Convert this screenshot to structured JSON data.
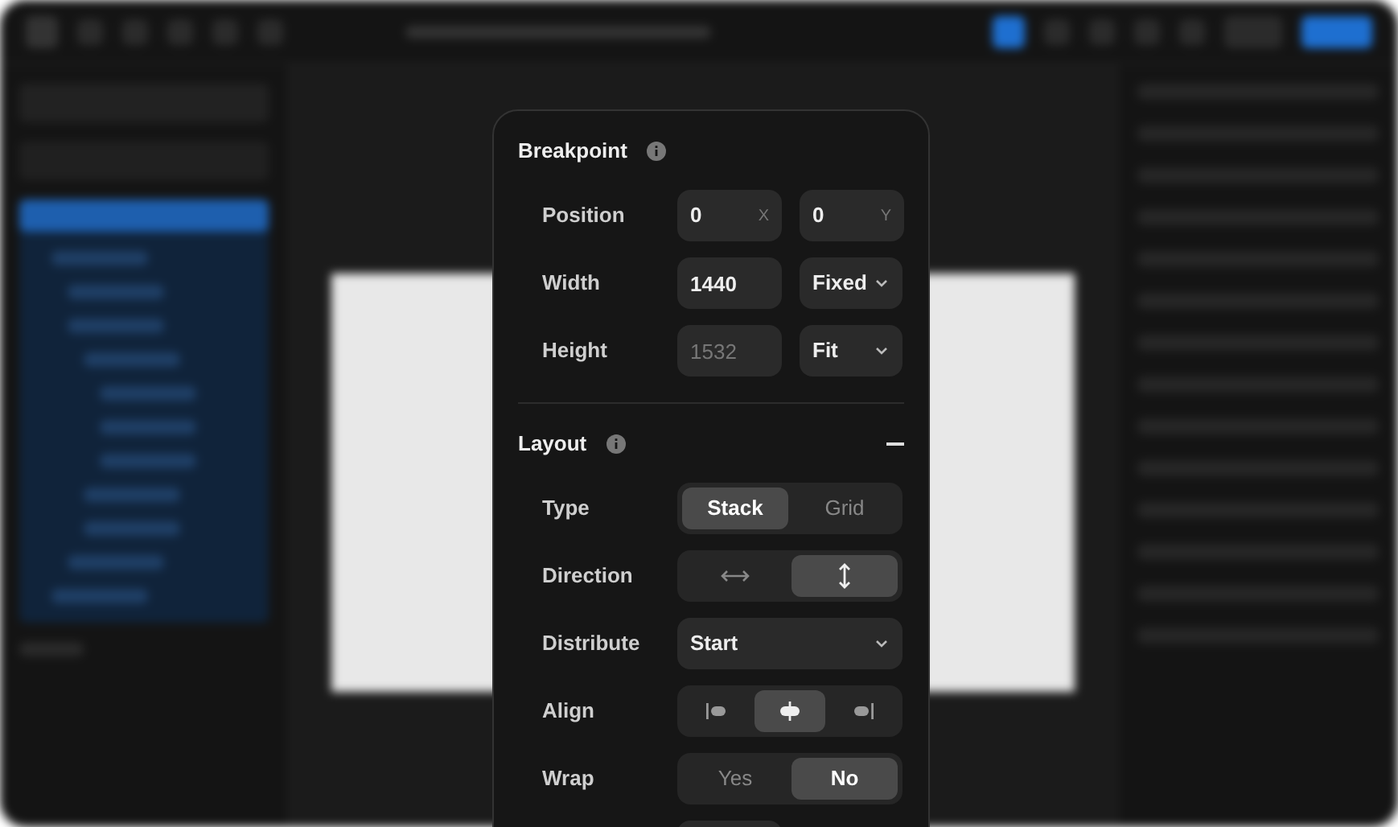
{
  "breakpoint": {
    "title": "Breakpoint",
    "rows": [
      {
        "label": "Position",
        "kind": "pair",
        "fields": [
          {
            "value": "0",
            "suffix": "X"
          },
          {
            "value": "0",
            "suffix": "Y"
          }
        ]
      },
      {
        "label": "Width",
        "kind": "field-select",
        "field": {
          "value": "1440"
        },
        "select": "Fixed"
      },
      {
        "label": "Height",
        "kind": "field-select",
        "field": {
          "placeholder": "1532"
        },
        "select": "Fit"
      }
    ]
  },
  "layout": {
    "title": "Layout",
    "expanded": true,
    "rows": [
      {
        "label": "Type",
        "kind": "text-toggle",
        "options": [
          {
            "label": "Stack",
            "selected": true
          },
          {
            "label": "Grid",
            "selected": false
          }
        ]
      },
      {
        "label": "Direction",
        "kind": "direction",
        "options": [
          {
            "selected": false
          },
          {
            "selected": true
          }
        ]
      },
      {
        "label": "Distribute",
        "kind": "select",
        "value": "Start"
      },
      {
        "label": "Align",
        "kind": "align",
        "options": [
          {
            "selected": false
          },
          {
            "selected": true
          },
          {
            "selected": false
          }
        ]
      },
      {
        "label": "Wrap",
        "kind": "text-toggle",
        "options": [
          {
            "label": "Yes",
            "selected": false
          },
          {
            "label": "No",
            "selected": true
          }
        ]
      }
    ]
  }
}
